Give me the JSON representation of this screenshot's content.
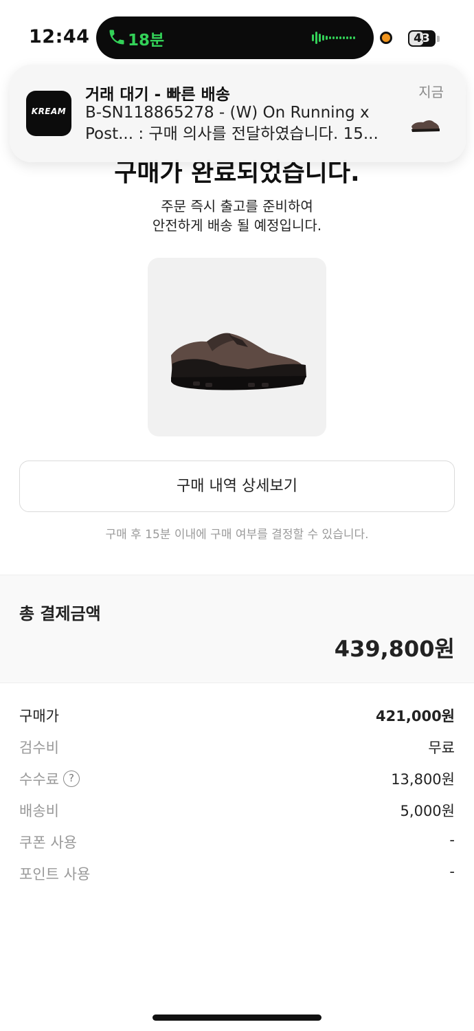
{
  "status_bar": {
    "time": "12:44",
    "call_duration": "18분",
    "battery": "43",
    "call_color": "#33d158"
  },
  "notification": {
    "app_icon_text": "KREAM",
    "title": "거래 대기 - 빠른 배송",
    "body": "B-SN118865278 - (W) On Running x Post... : 구매 의사를 전달하였습니다. 15...",
    "time": "지금"
  },
  "header": {
    "title": "구매가 완료되었습니다.",
    "subtitle_line1": "주문 즉시 출고를 준비하여",
    "subtitle_line2": "안전하게 배송 될 예정입니다."
  },
  "detail_button": {
    "label": "구매 내역 상세보기"
  },
  "helper_text": "구매 후 15분 이내에 구매 여부를 결정할 수 있습니다.",
  "total": {
    "label": "총 결제금액",
    "value": "439,800원"
  },
  "breakdown": [
    {
      "label": "구매가",
      "value": "421,000원"
    },
    {
      "label": "검수비",
      "value": "무료"
    },
    {
      "label": "수수료",
      "value": "13,800원"
    },
    {
      "label": "배송비",
      "value": "5,000원"
    },
    {
      "label": "쿠폰 사용",
      "value": "-"
    },
    {
      "label": "포인트 사용",
      "value": "-"
    }
  ],
  "icons": {
    "call": "phone-icon",
    "help": "question-circle-icon",
    "help_glyph": "?"
  }
}
